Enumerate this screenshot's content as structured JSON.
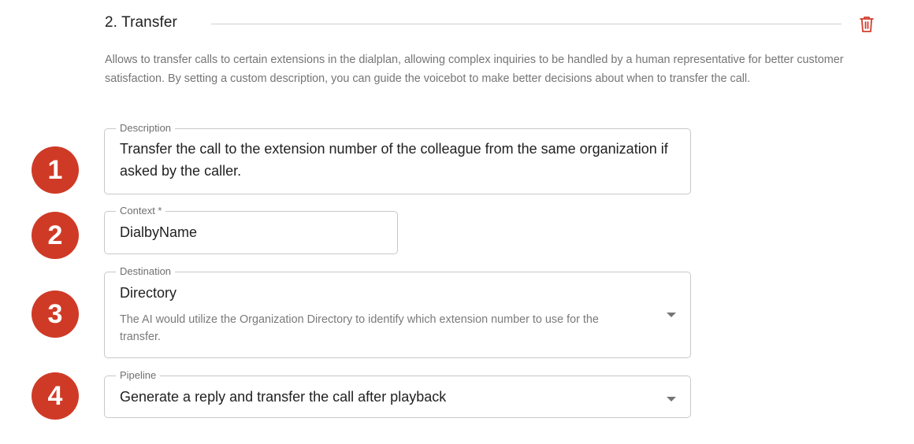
{
  "section": {
    "title": "2.  Transfer",
    "description": "Allows to transfer calls to certain extensions in the dialplan, allowing complex inquiries to be handled by a human representative for better customer satisfaction. By setting a custom description, you can guide the voicebot to make better decisions about when to transfer the call."
  },
  "fields": {
    "description": {
      "label": "Description",
      "value": "Transfer the call to the extension number of the colleague from the same organization if asked by the caller."
    },
    "context": {
      "label": "Context *",
      "value": "DialbyName"
    },
    "destination": {
      "label": "Destination",
      "value": "Directory",
      "hint": "The AI would utilize the Organization Directory to identify which extension number to use for the transfer."
    },
    "pipeline": {
      "label": "Pipeline",
      "value": "Generate a reply and transfer the call after playback"
    }
  },
  "badges": [
    "1",
    "2",
    "3",
    "4"
  ],
  "colors": {
    "badge": "#cf3a26",
    "delete_icon": "#d23f2f",
    "border": "#c8c8c8"
  },
  "icons": {
    "delete": "trash-icon",
    "dropdown": "chevron-down-icon"
  }
}
